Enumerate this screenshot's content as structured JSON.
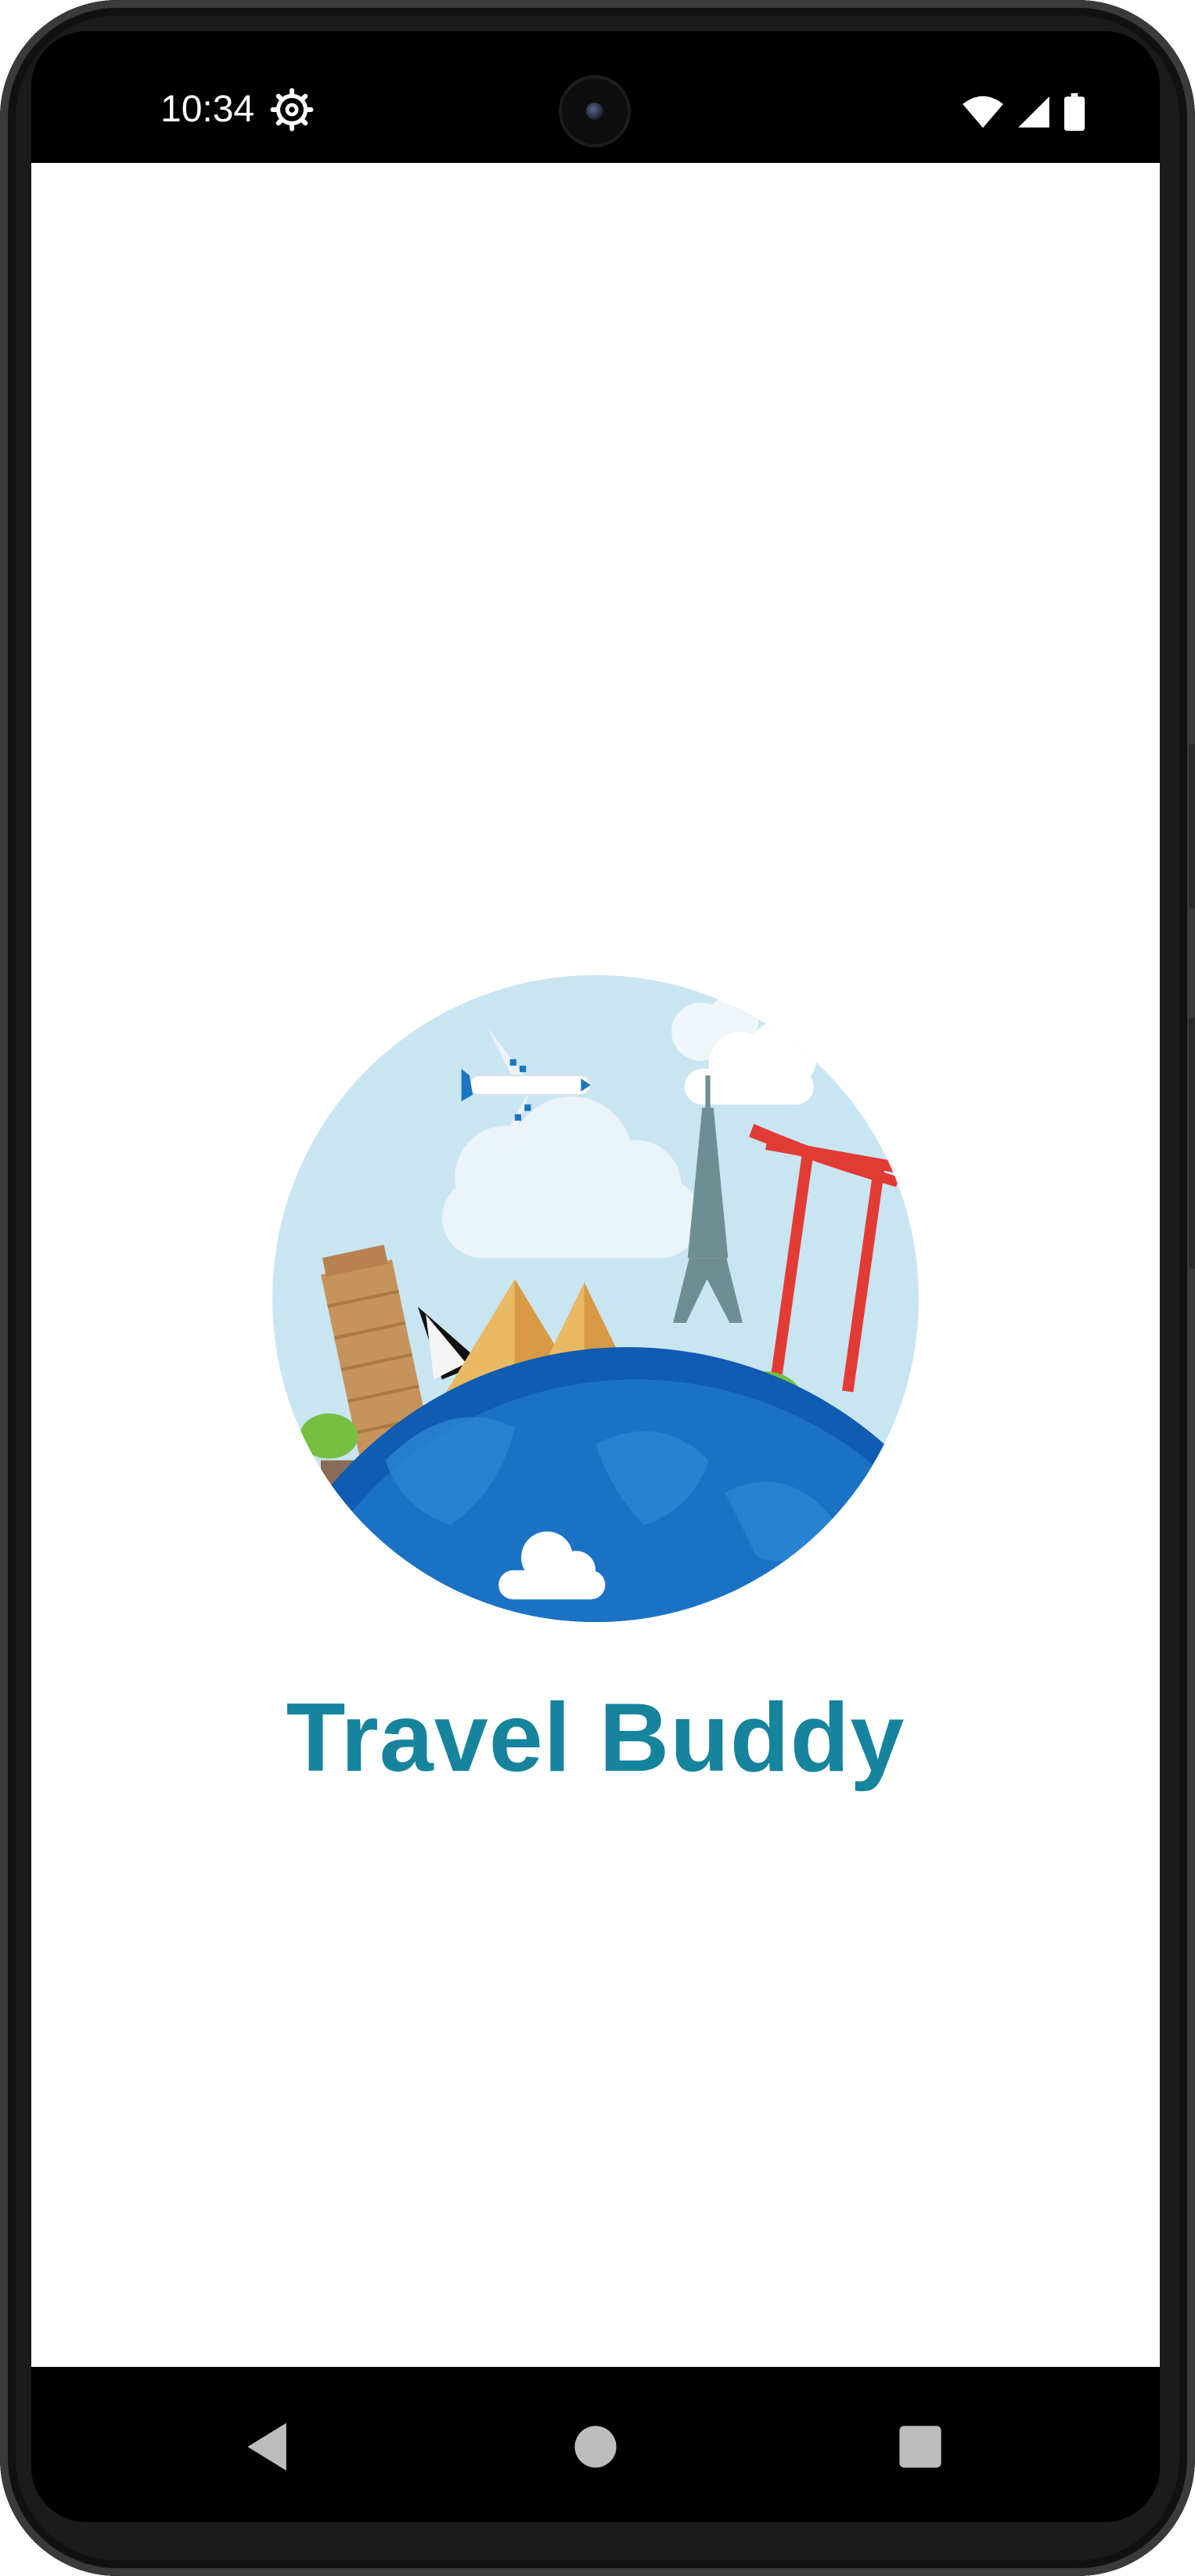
{
  "status_bar": {
    "time": "10:34",
    "icons": [
      "settings-gear-icon",
      "wifi-icon",
      "cellular-signal-icon",
      "battery-icon"
    ]
  },
  "app": {
    "title": "Travel Buddy",
    "title_color": "#16849c",
    "logo": "travel-globe-landmarks-illustration"
  },
  "nav_bar": {
    "buttons": [
      "back-triangle-icon",
      "home-circle-icon",
      "recents-square-icon"
    ]
  }
}
